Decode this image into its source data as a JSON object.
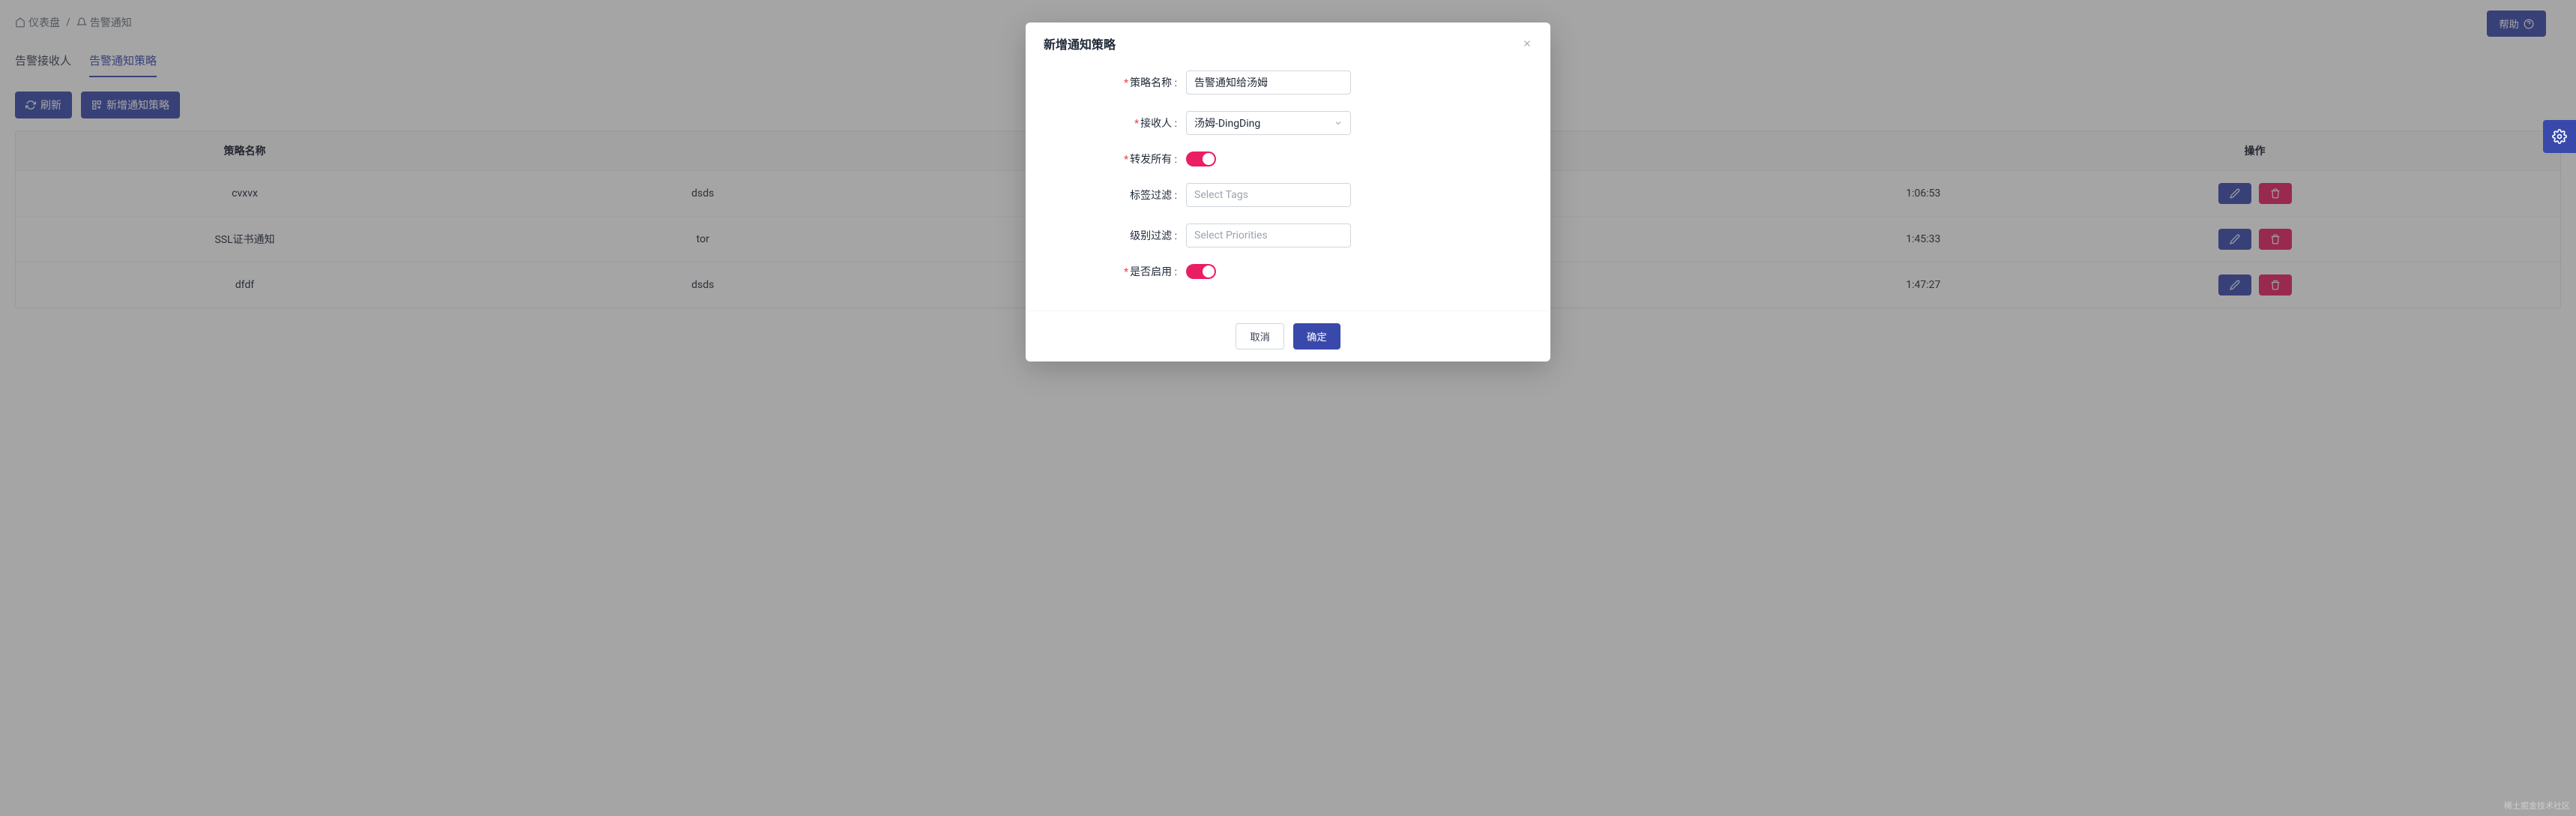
{
  "breadcrumb": {
    "dashboard": "仪表盘",
    "current": "告警通知"
  },
  "help_label": "帮助",
  "tabs": {
    "receivers": "告警接收人",
    "policies": "告警通知策略"
  },
  "toolbar": {
    "refresh": "刷新",
    "add_policy": "新增通知策略"
  },
  "table": {
    "headers": {
      "name": "策略名称",
      "action": "操作"
    },
    "rows": [
      {
        "name": "cvxvx",
        "col2": "dsds",
        "time": "1:06:53"
      },
      {
        "name": "SSL证书通知",
        "col2": "tor",
        "time": "1:45:33"
      },
      {
        "name": "dfdf",
        "col2": "dsds",
        "time": "1:47:27"
      }
    ]
  },
  "modal": {
    "title": "新增通知策略",
    "fields": {
      "name_label": "策略名称",
      "name_value": "告警通知给汤姆",
      "receiver_label": "接收人",
      "receiver_value": "汤姆-DingDing",
      "forward_all_label": "转发所有",
      "tag_filter_label": "标签过滤",
      "tag_filter_placeholder": "Select Tags",
      "level_filter_label": "级别过滤",
      "level_filter_placeholder": "Select Priorities",
      "enabled_label": "是否启用"
    },
    "footer": {
      "cancel": "取消",
      "ok": "确定"
    }
  },
  "watermark": "稀土掘金技术社区"
}
